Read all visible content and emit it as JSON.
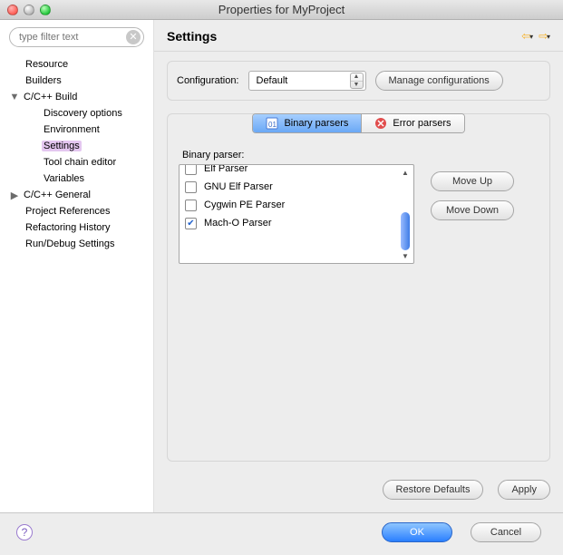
{
  "window": {
    "title": "Properties for MyProject"
  },
  "sidebar": {
    "filter_placeholder": "type filter text",
    "items": [
      {
        "label": "Resource",
        "depth": 0
      },
      {
        "label": "Builders",
        "depth": 0
      },
      {
        "label": "C/C++ Build",
        "depth": 0,
        "expanded": true
      },
      {
        "label": "Discovery options",
        "depth": 1
      },
      {
        "label": "Environment",
        "depth": 1
      },
      {
        "label": "Settings",
        "depth": 1,
        "selected": true
      },
      {
        "label": "Tool chain editor",
        "depth": 1
      },
      {
        "label": "Variables",
        "depth": 1
      },
      {
        "label": "C/C++ General",
        "depth": 0,
        "expandable": true
      },
      {
        "label": "Project References",
        "depth": 0
      },
      {
        "label": "Refactoring History",
        "depth": 0
      },
      {
        "label": "Run/Debug Settings",
        "depth": 0
      }
    ]
  },
  "main": {
    "title": "Settings",
    "config_label": "Configuration:",
    "config_value": "Default",
    "manage_btn": "Manage configurations",
    "tabs": [
      {
        "label": "Binary parsers",
        "icon": "binary",
        "active": true
      },
      {
        "label": "Error parsers",
        "icon": "error"
      }
    ],
    "parser_label": "Binary parser:",
    "parsers": [
      {
        "label": "Elf Parser",
        "checked": false,
        "partial_top": true
      },
      {
        "label": "GNU Elf Parser",
        "checked": false
      },
      {
        "label": "Cygwin PE Parser",
        "checked": false
      },
      {
        "label": "Mach-O Parser",
        "checked": true
      }
    ],
    "move_up": "Move Up",
    "move_down": "Move Down",
    "restore_defaults": "Restore Defaults",
    "apply": "Apply"
  },
  "footer": {
    "ok": "OK",
    "cancel": "Cancel"
  }
}
